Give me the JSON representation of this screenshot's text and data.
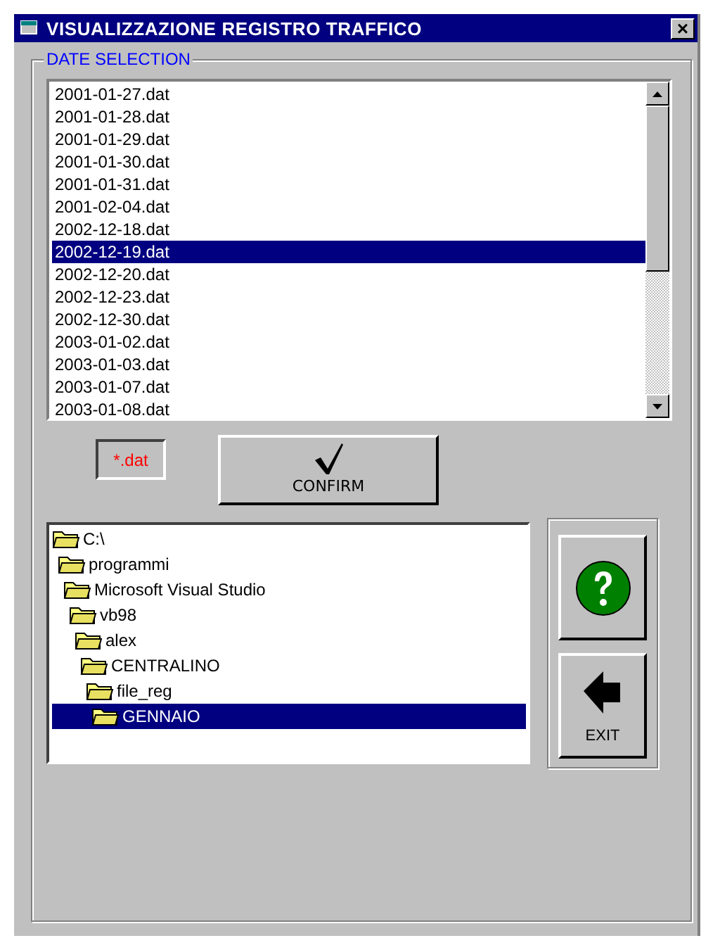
{
  "window": {
    "title": "VISUALIZZAZIONE REGISTRO TRAFFICO",
    "close": "×"
  },
  "date_selection": {
    "label": "DATE SELECTION",
    "files": [
      {
        "name": "2001-01-27.dat",
        "selected": false
      },
      {
        "name": "2001-01-28.dat",
        "selected": false
      },
      {
        "name": "2001-01-29.dat",
        "selected": false
      },
      {
        "name": "2001-01-30.dat",
        "selected": false
      },
      {
        "name": "2001-01-31.dat",
        "selected": false
      },
      {
        "name": "2001-02-04.dat",
        "selected": false
      },
      {
        "name": "2002-12-18.dat",
        "selected": false
      },
      {
        "name": "2002-12-19.dat",
        "selected": true
      },
      {
        "name": "2002-12-20.dat",
        "selected": false
      },
      {
        "name": "2002-12-23.dat",
        "selected": false
      },
      {
        "name": "2002-12-30.dat",
        "selected": false
      },
      {
        "name": "2003-01-02.dat",
        "selected": false
      },
      {
        "name": "2003-01-03.dat",
        "selected": false
      },
      {
        "name": "2003-01-07.dat",
        "selected": false
      },
      {
        "name": "2003-01-08.dat",
        "selected": false
      }
    ],
    "filter": "*.dat",
    "confirm": "CONFIRM",
    "folders": [
      {
        "name": "C:\\",
        "selected": false,
        "children": [
          {
            "name": "programmi",
            "selected": false,
            "children": [
              {
                "name": "Microsoft Visual Studio",
                "selected": false,
                "children": [
                  {
                    "name": "vb98",
                    "selected": false,
                    "children": [
                      {
                        "name": "alex",
                        "selected": false,
                        "children": [
                          {
                            "name": "CENTRALINO",
                            "selected": false,
                            "children": [
                              {
                                "name": "file_reg",
                                "selected": false,
                                "children": [
                                  {
                                    "name": "GENNAIO",
                                    "selected": true
                                  }
                                ]
                              }
                            ]
                          }
                        ]
                      }
                    ]
                  }
                ]
              }
            ]
          }
        ]
      }
    ],
    "exit": "EXIT"
  }
}
